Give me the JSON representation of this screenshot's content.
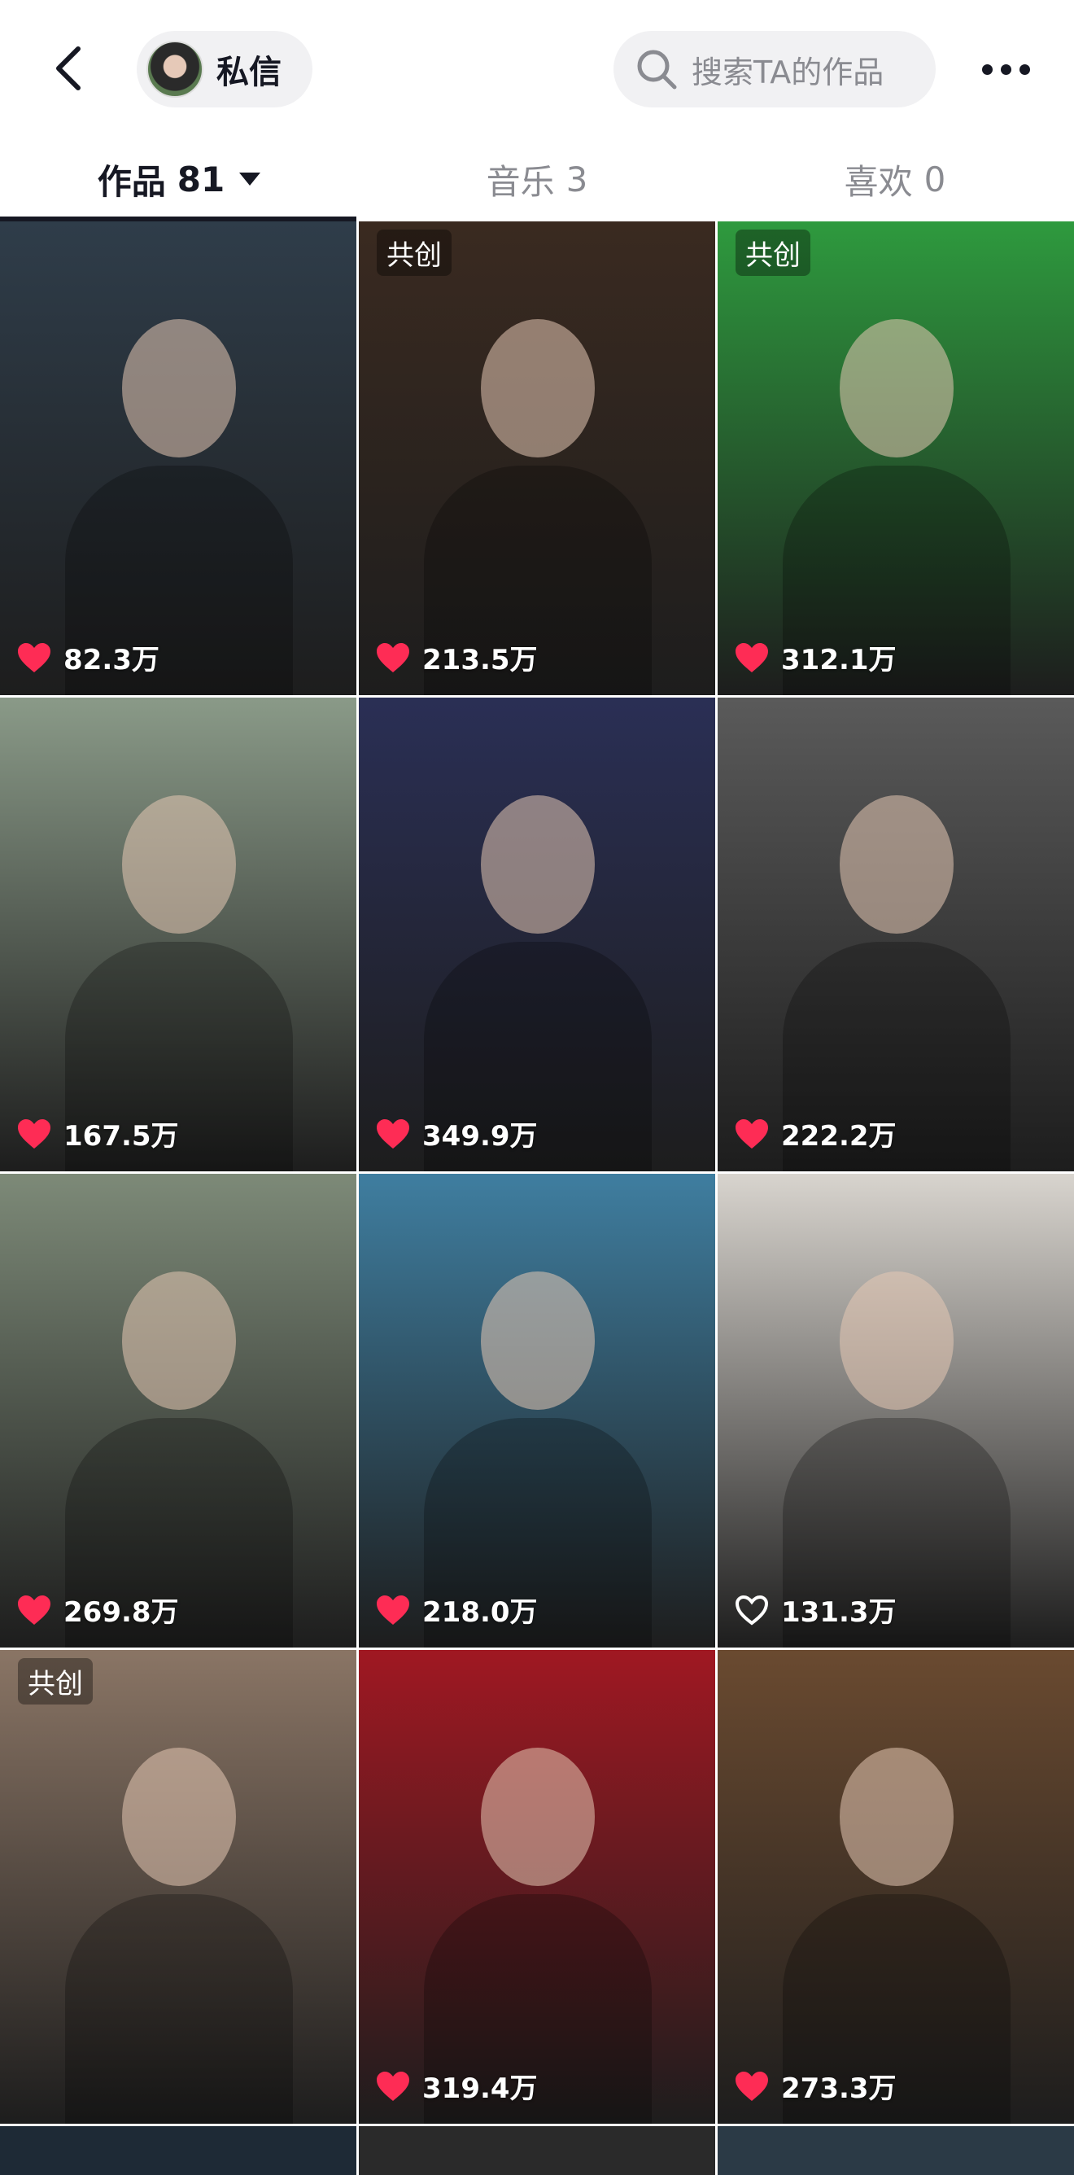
{
  "header": {
    "chat_label": "私信",
    "search_placeholder": "搜索TA的作品"
  },
  "tabs": [
    {
      "label": "作品",
      "count": "81"
    },
    {
      "label": "音乐",
      "count": "3"
    },
    {
      "label": "喜欢",
      "count": "0"
    }
  ],
  "grid": {
    "badge_label": "共创",
    "items": [
      {
        "likes": "82.3万",
        "bg": "#2f3d4a"
      },
      {
        "likes": "213.5万",
        "bg": "#3a2a20",
        "badge": "共创"
      },
      {
        "likes": "312.1万",
        "bg": "#2e9a3e",
        "badge": "共创"
      },
      {
        "likes": "167.5万",
        "bg": "#8a9a88"
      },
      {
        "likes": "349.9万",
        "bg": "#2a2f55"
      },
      {
        "likes": "222.2万",
        "bg": "#5a5a5a"
      },
      {
        "likes": "269.8万",
        "bg": "#7d8a78"
      },
      {
        "likes": "218.0万",
        "bg": "#3f7ea0"
      },
      {
        "likes": "131.3万",
        "bg": "#d8d4ce",
        "liked": false
      },
      {
        "likes": "",
        "bg": "#8a7565",
        "badge": "共创"
      },
      {
        "likes": "319.4万",
        "bg": "#a01822"
      },
      {
        "likes": "273.3万",
        "bg": "#6a4a30"
      }
    ]
  },
  "colors": {
    "like_heart": "#fe2c55",
    "text_primary": "#161823",
    "text_secondary": "#8a8b91"
  }
}
